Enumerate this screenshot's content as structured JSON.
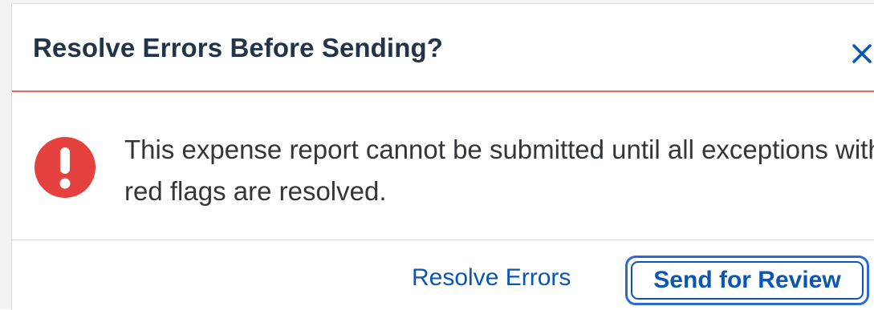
{
  "dialog": {
    "title": "Resolve Errors Before Sending?",
    "close_icon": "close-icon",
    "message": "This expense report cannot be submitted until all exceptions with red flags are resolved.",
    "alert_icon": "error-exclamation-icon",
    "resolve_label": "Resolve Errors",
    "send_label": "Send for Review"
  },
  "colors": {
    "title": "#223548",
    "accent": "#0a56b3",
    "focus_ring": "#2b6ad3",
    "error": "#e5413e",
    "divider_error": "#e06767"
  }
}
